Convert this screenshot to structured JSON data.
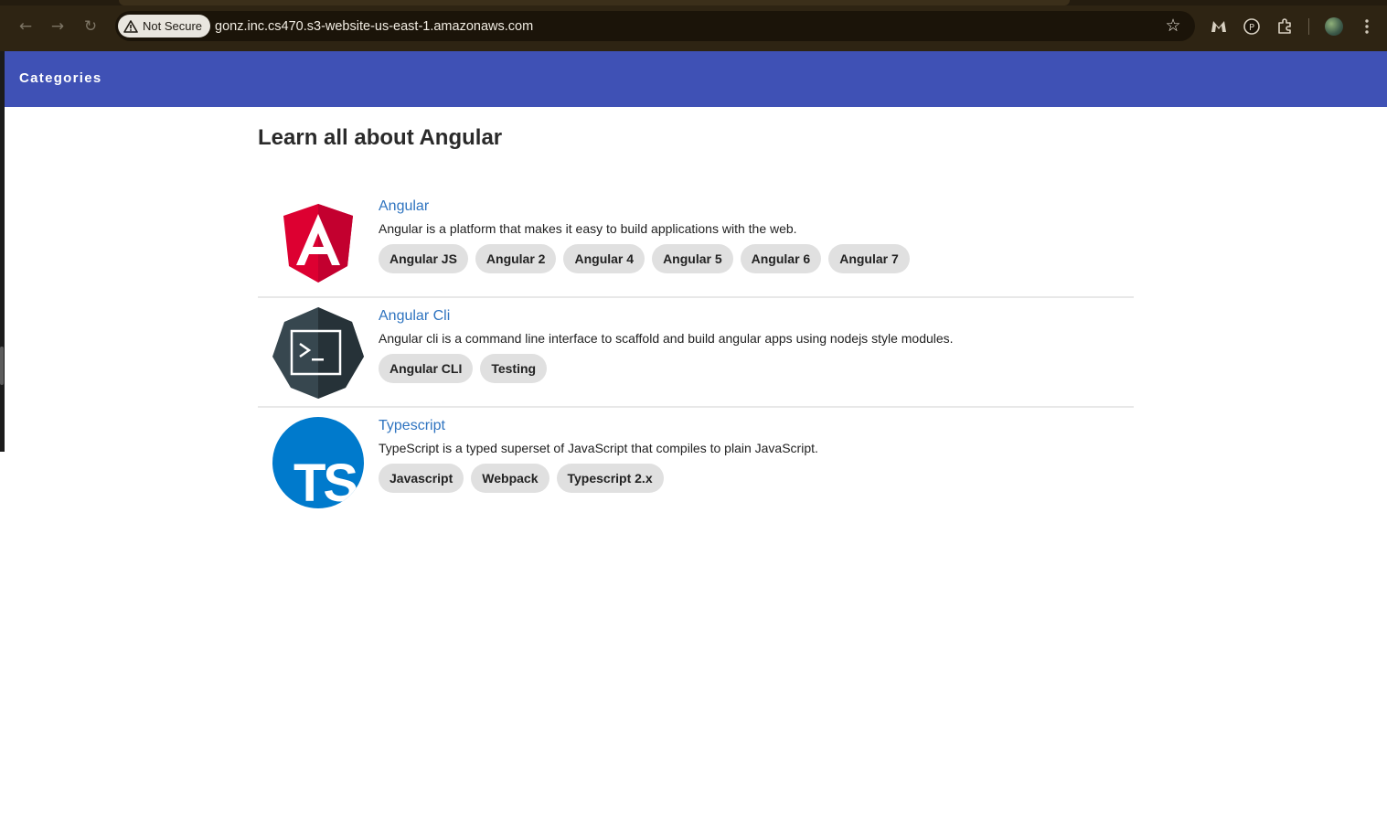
{
  "browser": {
    "security_label": "Not Secure",
    "url": "gonz.inc.cs470.s3-website-us-east-1.amazonaws.com",
    "icons": [
      "back-arrow-icon",
      "forward-arrow-icon",
      "reload-icon",
      "warning-triangle-icon",
      "bookmark-star-icon",
      "malwarebytes-extension-icon",
      "privacy-extension-icon",
      "extensions-puzzle-icon",
      "profile-avatar",
      "kebab-menu-icon"
    ]
  },
  "toolbar": {
    "title": "Categories"
  },
  "page": {
    "title": "Learn all about Angular"
  },
  "categories": [
    {
      "title": "Angular",
      "description": "Angular is a platform that makes it easy to build applications with the web.",
      "logo": "angular-shield-logo",
      "tags": [
        "Angular JS",
        "Angular 2",
        "Angular 4",
        "Angular 5",
        "Angular 6",
        "Angular 7"
      ]
    },
    {
      "title": "Angular Cli",
      "description": "Angular cli is a command line interface to scaffold and build angular apps using nodejs style modules.",
      "logo": "terminal-logo",
      "tags": [
        "Angular CLI",
        "Testing"
      ]
    },
    {
      "title": "Typescript",
      "description": "TypeScript is a typed superset of JavaScript that compiles to plain JavaScript.",
      "logo": "typescript-logo",
      "logo_text": "TS",
      "tags": [
        "Javascript",
        "Webpack",
        "Typescript 2.x"
      ]
    }
  ],
  "colors": {
    "toolbar": "#3f51b5",
    "link": "#2f74c0",
    "chip": "#e0e0e0",
    "angular_red": "#dd0031",
    "angular_dark_red": "#c3002f",
    "typescript_blue": "#007acc"
  }
}
